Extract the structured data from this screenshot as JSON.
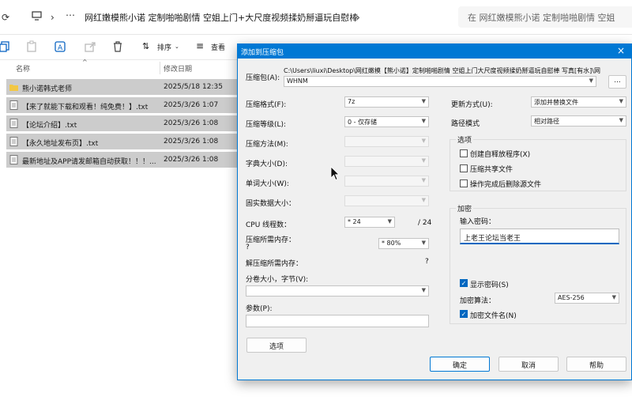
{
  "address": {
    "path": "网红嫩模熊小诺 定制啪啪剧情 空姐上门+大尺度视频揉奶掰逼玩自慰棒",
    "search_placeholder": "在 网红嫩模熊小诺 定制啪啪剧情 空姐"
  },
  "toolbar": {
    "sort_label": "排序",
    "view_label": "查看"
  },
  "files": {
    "col_name": "名称",
    "col_date": "修改日期",
    "rows": [
      {
        "name": "熊小诺韩式老师",
        "date": "2025/5/18 12:35",
        "type": "folder"
      },
      {
        "name": "【来了就能下载和观看！纯免费！】.txt",
        "date": "2025/3/26 1:07",
        "type": "txt"
      },
      {
        "name": "【论坛介绍】.txt",
        "date": "2025/3/26 1:08",
        "type": "txt"
      },
      {
        "name": "【永久地址发布页】.txt",
        "date": "2025/3/26 1:08",
        "type": "txt"
      },
      {
        "name": "最新地址及APP请发邮箱自动获取！！！...",
        "date": "2025/3/26 1:08",
        "type": "txt"
      }
    ]
  },
  "dialog": {
    "title": "添加到压缩包",
    "archive_label": "压缩包(A):",
    "archive_path": "C:\\Users\\liuxi\\Desktop\\网红嫩模【熊小诺】定制啪啪剧情 空姐上门大尺度视频揉奶掰逼玩自慰棒 写真[有水]\\网",
    "archive_name": "WHNM",
    "browse_label": "...",
    "format_label": "压缩格式(F):",
    "format_value": "7z",
    "level_label": "压缩等级(L):",
    "level_value": "0 - 仅存储",
    "method_label": "压缩方法(M):",
    "dict_label": "字典大小(D):",
    "word_label": "单词大小(W):",
    "solid_label": "固实数据大小：",
    "cpu_label": "CPU 线程数：",
    "cpu_value": "* 24",
    "cpu_total": "/ 24",
    "mem_comp_label": "压缩所需内存：",
    "mem_comp_q": "?",
    "mem_value": "* 80%",
    "mem_decomp_label": "解压缩所需内存：",
    "mem_decomp_q": "?",
    "split_label": "分卷大小，字节(V):",
    "params_label": "参数(P):",
    "options_btn": "选项",
    "update_label": "更新方式(U):",
    "update_value": "添加并替换文件",
    "pathmode_label": "路径模式",
    "pathmode_value": "相对路径",
    "opts_group": "选项",
    "opt_sfx": "创建自释放程序(X)",
    "opt_shared": "压缩共享文件",
    "opt_delete": "操作完成后删除源文件",
    "enc_group": "加密",
    "pw_label": "输入密码：",
    "pw_value": "上老王论坛当老王",
    "show_pw": "显示密码(S)",
    "enc_method_label": "加密算法：",
    "enc_method_value": "AES-256",
    "enc_names": "加密文件名(N)",
    "ok": "确定",
    "cancel": "取消",
    "help": "帮助"
  }
}
